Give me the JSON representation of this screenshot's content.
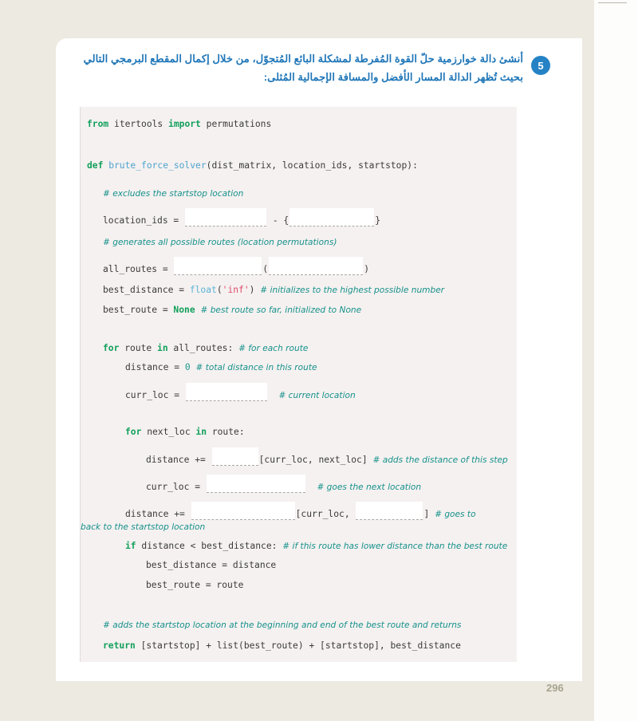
{
  "page": {
    "number": "296",
    "background_color": "#eceae1",
    "card_color": "#ffffff"
  },
  "question": {
    "badge": "5",
    "accent_color": "#2482c5",
    "text_color": "#1f76b8",
    "text": "أنشئ دالة خوارزمية حلّ القوة المُفرطة لمشكلة البائع المُتجوّل، من خلال إكمال المقطع البرمجي التالي بحيث تُظهر الدالة المسار الأفضل والمسافة الإجمالية المُثلى:"
  },
  "code": {
    "background_color": "#f5f1f0",
    "keyword_color": "#13a05c",
    "function_color": "#4fa3cf",
    "string_color": "#e0496b",
    "comment_color": "#15918b",
    "number_color": "#1f9a8f",
    "lines": {
      "l1_kw_from": "from",
      "l1_module": " itertools ",
      "l1_kw_import": "import",
      "l1_name": " permutations",
      "l2_kw_def": "def",
      "l2_fnname": " brute_force_solver",
      "l2_sig": "(dist_matrix, location_ids, startstop):",
      "c1": "# excludes the startstop location",
      "l3_lhs": "location_ids = ",
      "l3_mid": " - {",
      "l3_end": "}",
      "c2": "# generates all possible routes (location permutations)",
      "l4_lhs": "all_routes = ",
      "l4_mid": "(",
      "l4_end": ")",
      "l5_lhs": "best_distance = ",
      "l5_float": "float",
      "l5_paren_open": "(",
      "l5_str": "'inf'",
      "l5_paren_close": ")",
      "l5_cmt": "# initializes to the highest possible number",
      "l6_lhs": "best_route = ",
      "l6_none": "None",
      "l6_cmt": "# best route so far, initialized to None",
      "l7_kw_for": "for",
      "l7_var": " route ",
      "l7_kw_in": "in",
      "l7_iter": " all_routes:",
      "l7_cmt": "# for each route",
      "l8_lhs": "distance = ",
      "l8_num": "0",
      "l8_cmt": "# total distance in this route",
      "l9_lhs": "curr_loc = ",
      "l9_cmt": "# current location",
      "l10_kw_for": "for",
      "l10_var": " next_loc ",
      "l10_kw_in": "in",
      "l10_iter": " route:",
      "l11_lhs": "distance += ",
      "l11_idx": "[curr_loc, next_loc]",
      "l11_cmt": "# adds the distance of this step",
      "l12_lhs": "curr_loc = ",
      "l12_cmt": "# goes the next location",
      "l13_lhs": "distance += ",
      "l13_idx": "[curr_loc, ",
      "l13_end": "]",
      "l13_cmt": "# goes to",
      "l13_cmt_wrap": "back to the startstop location",
      "l14_kw_if": "if",
      "l14_cond": " distance < best_distance:",
      "l14_cmt": "# if this route has lower distance than the best route",
      "l15": "best_distance = distance",
      "l16": "best_route = route",
      "c3": "# adds the startstop location at the beginning and end of the best route and returns",
      "l17_kw_return": "return",
      "l17_body": " [startstop] + list(best_route) + [startstop], best_distance"
    }
  }
}
